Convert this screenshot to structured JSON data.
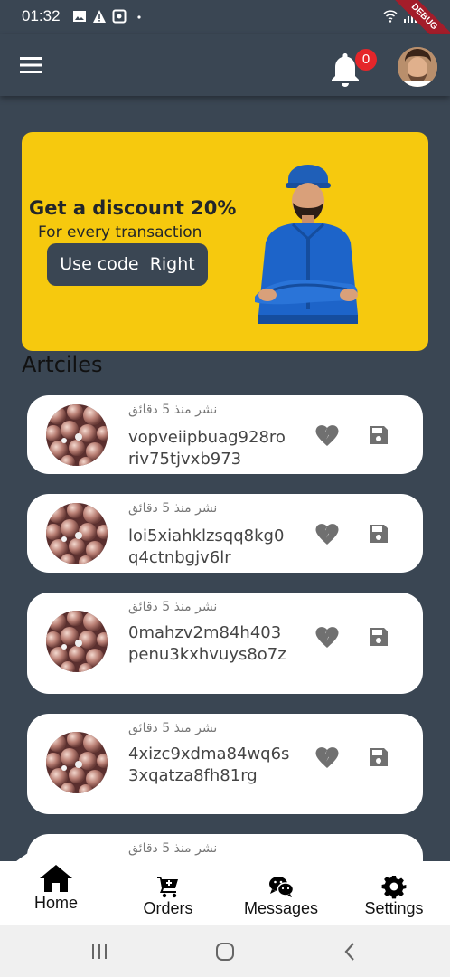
{
  "status_bar": {
    "time": "01:32",
    "debug_label": "DEBUG"
  },
  "app_bar": {
    "notification_count": "0"
  },
  "banner": {
    "title": "Get a discount 20%",
    "subtitle": "For every transaction",
    "button_label": "Use code  Right"
  },
  "section_title": "Artciles",
  "articles": [
    {
      "meta": "نشر منذ 5 دقائق",
      "title": "vopveiipbuag928roriv75tjvxb973"
    },
    {
      "meta": "نشر منذ 5 دقائق",
      "title": "loi5xiahklzsqq8kg0q4ctnbgjv6lr"
    },
    {
      "meta": "نشر منذ 5 دقائق",
      "title": "0mahzv2m84h403penu3kxhvuys8o7z"
    },
    {
      "meta": "نشر منذ 5 دقائق",
      "title": "4xizc9xdma84wq6s3xqatza8fh81rg"
    },
    {
      "meta": "نشر منذ 5 دقائق",
      "title": ""
    }
  ],
  "bottom_nav": {
    "items": [
      {
        "label": "Home",
        "icon": "home-icon"
      },
      {
        "label": "Orders",
        "icon": "cart-icon"
      },
      {
        "label": "Messages",
        "icon": "wechat-icon"
      },
      {
        "label": "Settings",
        "icon": "gear-icon"
      }
    ]
  },
  "colors": {
    "background": "#3a4653",
    "banner": "#f6c90e",
    "badge": "#e5262a"
  }
}
